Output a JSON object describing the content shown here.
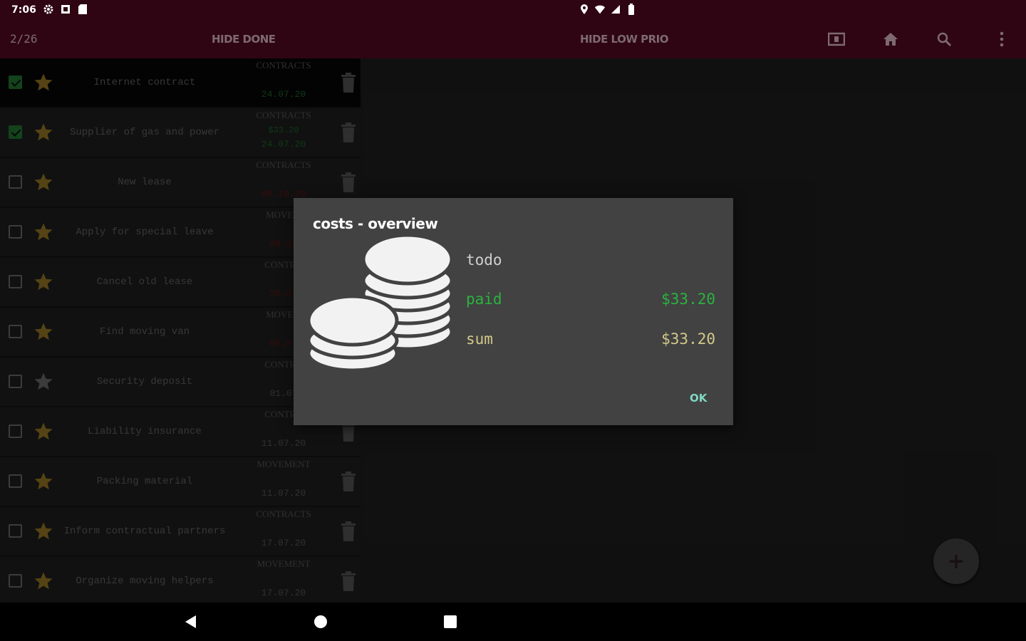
{
  "status_bar": {
    "time": "7:06",
    "left_icons": [
      "settings-icon",
      "notification-icon",
      "sd-card-icon"
    ],
    "right_icons": [
      "location-icon",
      "wifi-icon",
      "signal-icon",
      "battery-icon"
    ]
  },
  "toolbar": {
    "count": "2/26",
    "hide_done": "HIDE DONE",
    "hide_low_prio": "HIDE LOW PRIO",
    "icons": [
      "layout-toggle-icon",
      "home-icon",
      "search-icon",
      "overflow-menu-icon"
    ]
  },
  "tasks": [
    {
      "title": "Internet contract",
      "category": "CONTRACTS",
      "date": "24.07.20",
      "cost": "",
      "done": true,
      "starred": true
    },
    {
      "title": "Supplier of gas and power",
      "category": "CONTRACTS",
      "date": "24.07.20",
      "cost": "$33.20",
      "done": true,
      "starred": true
    },
    {
      "title": "New lease",
      "category": "CONTRACTS",
      "date": "08.10.20",
      "cost": "",
      "done": false,
      "starred": true
    },
    {
      "title": "Apply for special leave",
      "category": "MOVEM",
      "date": "09.03",
      "cost": "",
      "done": false,
      "starred": true
    },
    {
      "title": "Cancel old lease",
      "category": "CONTRA",
      "date": "25.07",
      "cost": "",
      "done": false,
      "starred": true
    },
    {
      "title": "Find moving van",
      "category": "MOVEM",
      "date": "05.07",
      "cost": "",
      "done": false,
      "starred": true
    },
    {
      "title": "Security deposit",
      "category": "CONTRA",
      "date": "01.07",
      "cost": "",
      "done": false,
      "starred": false
    },
    {
      "title": "Liability insurance",
      "category": "CONTRA",
      "date": "11.07.20",
      "cost": "",
      "done": false,
      "starred": true
    },
    {
      "title": "Packing material",
      "category": "MOVEMENT",
      "date": "11.07.20",
      "cost": "",
      "done": false,
      "starred": true
    },
    {
      "title": "Inform contractual partners",
      "category": "CONTRACTS",
      "date": "17.07.20",
      "cost": "",
      "done": false,
      "starred": true
    },
    {
      "title": "Organize moving helpers",
      "category": "MOVEMENT",
      "date": "17.07.20",
      "cost": "",
      "done": false,
      "starred": true
    }
  ],
  "colors": {
    "date_done": "#1b5b27",
    "date_overdue": "#5a1313",
    "date_future": "#4f4f4f",
    "star_active": "#8a6d22",
    "star_inactive": "#5f5f5f"
  },
  "dialog": {
    "title": "costs - overview",
    "icon": "coins-icon",
    "rows": [
      {
        "label": "todo",
        "value": "",
        "color": "#cfcfcf"
      },
      {
        "label": "paid",
        "value": "$33.20",
        "color": "#2ab33e"
      },
      {
        "label": "sum",
        "value": "$33.20",
        "color": "#d4c98a"
      }
    ],
    "ok_label": "OK"
  },
  "fab": {
    "label": "+"
  },
  "nav_bar": {
    "icons": [
      "back-icon",
      "home-circle-icon",
      "recents-icon"
    ]
  }
}
